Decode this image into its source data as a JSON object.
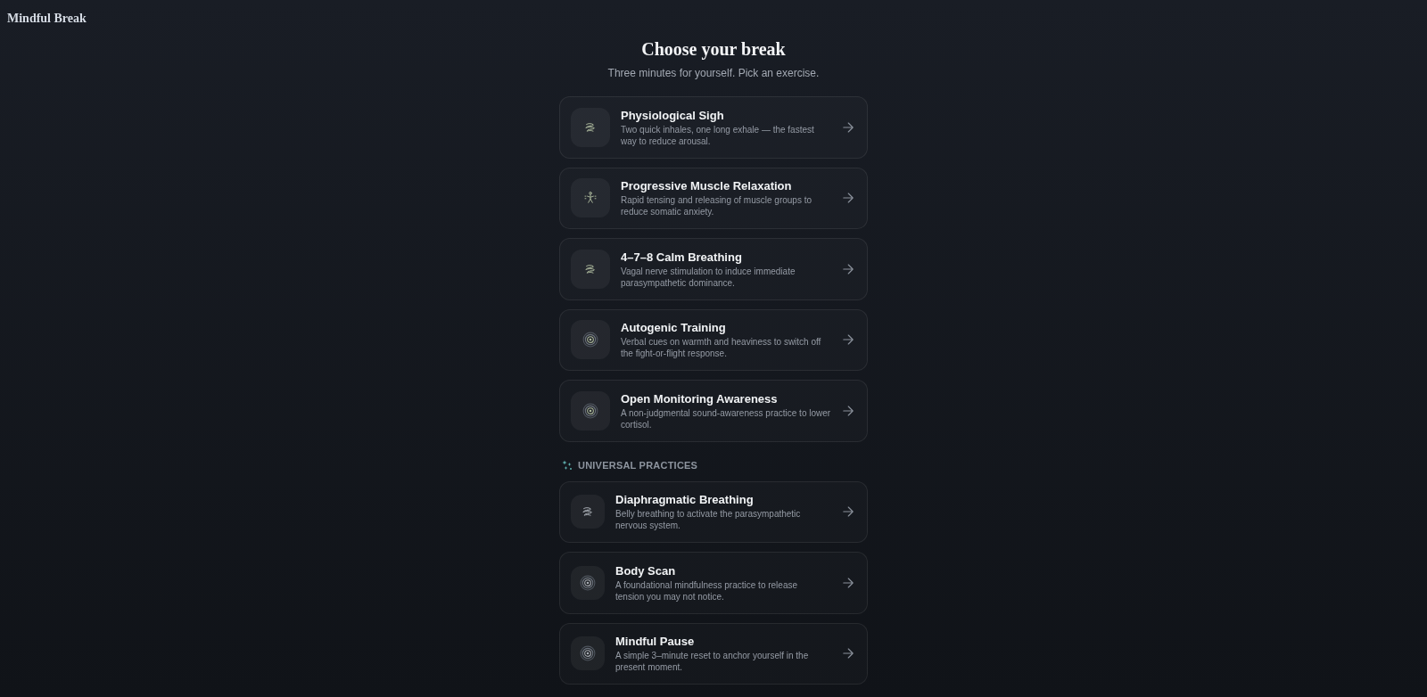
{
  "header": {
    "logo": "Mindful Break"
  },
  "intro": {
    "title": "Choose your break",
    "subtitle": "Three minutes for yourself. Pick an exercise."
  },
  "exercises": [
    {
      "kind": "breath",
      "title": "Physiological Sigh",
      "description": "Two quick inhales, one long exhale — the fastest way to reduce arousal."
    },
    {
      "kind": "figure",
      "title": "Progressive Muscle Relaxation",
      "description": "Rapid tensing and releasing of muscle groups to reduce somatic anxiety."
    },
    {
      "kind": "breath",
      "title": "4–7–8 Calm Breathing",
      "description": "Vagal nerve stimulation to induce immediate parasympathetic dominance."
    },
    {
      "kind": "rings",
      "title": "Autogenic Training",
      "description": "Verbal cues on warmth and heaviness to switch off the fight-or-flight response."
    },
    {
      "kind": "rings",
      "title": "Open Monitoring Awareness",
      "description": "A non-judgmental sound-awareness practice to lower cortisol."
    }
  ],
  "universal_practices": {
    "heading": "UNIVERSAL PRACTICES",
    "exercises": [
      {
        "kind": "breath",
        "title": "Diaphragmatic Breathing",
        "description": "Belly breathing to activate the parasympathetic nervous system."
      },
      {
        "kind": "rings",
        "title": "Body Scan",
        "description": "A foundational mindfulness practice to release tension you may not notice."
      },
      {
        "kind": "rings",
        "title": "Mindful Pause",
        "description": "A simple 3–minute reset to anchor yourself in the present moment."
      }
    ]
  }
}
